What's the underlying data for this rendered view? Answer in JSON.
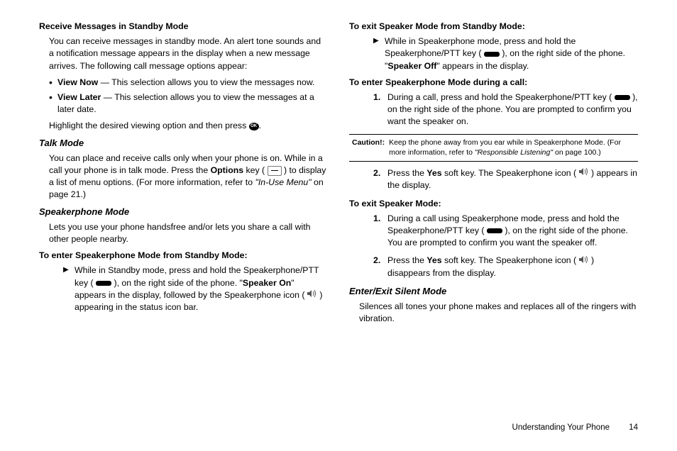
{
  "left": {
    "h1": "Receive Messages in Standby Mode",
    "p1": "You can receive messages in standby mode. An alert tone sounds and a notification message appears in the display when a new message arrives. The following call message options appear:",
    "bul1_b": "View Now",
    "bul1_t": " — This selection allows you to view the messages now.",
    "bul2_b": "View Later",
    "bul2_t": " — This selection allows you to view the messages at a later date.",
    "p2a": "Highlight the desired viewing option and then press ",
    "p2b": ".",
    "h2": "Talk Mode",
    "p3a": "You can place and receive calls only when your phone is on. While in a call your phone is in talk mode. Press the ",
    "p3b": "Options",
    "p3c": " key ( ",
    "p3d": " ) to display a list of menu options. (For more information, refer to ",
    "p3e": "\"In-Use Menu\"",
    "p3f": "  on page 21.)",
    "h3": "Speakerphone Mode",
    "p4": "Lets you use your phone handsfree and/or lets you share a call with other people nearby.",
    "h4": "To enter Speakerphone Mode from Standby Mode:",
    "tri1a": "While in Standby mode, press and hold the Speakerphone/PTT key ( ",
    "tri1b": " ), on the right side of the phone. \"",
    "tri1c": "Speaker On",
    "tri1d": "\" appears in the display, followed by the Speakerphone icon ( ",
    "tri1e": " ) appearing in the status icon bar."
  },
  "right": {
    "h1": "To exit Speaker Mode from Standby Mode:",
    "tri1a": "While in Speakerphone mode, press and hold the Speakerphone/PTT key ( ",
    "tri1b": " ), on the right side of the phone. \"",
    "tri1c": "Speaker Off",
    "tri1d": "\" appears in the display.",
    "h2": "To enter Speakerphone Mode during a call:",
    "n1a": "During a call, press and hold the Speakerphone/PTT key ( ",
    "n1b": " ), on the right side of the phone. You are prompted to confirm you want the speaker on.",
    "caution_lbl": "Caution!:",
    "caution_a": "Keep the phone away from you ear while in Speakerphone Mode. (For more information, refer to ",
    "caution_i": "\"Responsible Listening\"",
    "caution_b": "  on page 100.)",
    "n2a": "Press the ",
    "n2b": "Yes",
    "n2c": " soft key. The Speakerphone icon ( ",
    "n2d": " ) appears in the display.",
    "h3": "To exit Speaker Mode:",
    "n3a": "During a call using Speakerphone mode, press and hold the Speakerphone/PTT key ( ",
    "n3b": " ), on the right side of the phone. You are prompted to confirm you want the speaker off.",
    "n4a": "Press the ",
    "n4b": "Yes",
    "n4c": " soft key. The Speakerphone icon ( ",
    "n4d": " ) disappears from the display.",
    "h4": "Enter/Exit Silent Mode",
    "p5": "Silences all tones your phone makes and replaces all of the ringers with vibration."
  },
  "footer": {
    "section": "Understanding Your Phone",
    "page": "14"
  },
  "ok_label": "OK"
}
